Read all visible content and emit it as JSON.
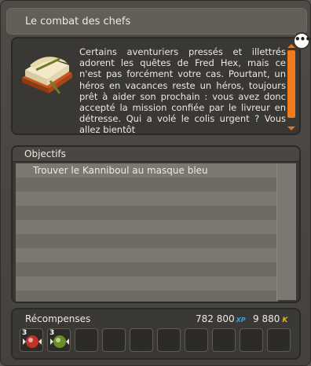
{
  "window": {
    "title": "Le combat des chefs"
  },
  "description": {
    "text": "Certains aventuriers pressés et illettrés adorent les quêtes de Fred Hex, mais ce n'est pas forcément votre cas. Pourtant, un héros en vacances reste un héros, toujours prêt à aider son prochain : vous avez donc accepté la mission confiée par le livreur en détresse. Qui a volé le colis urgent ? Vous allez bientôt"
  },
  "objectives": {
    "header": "Objectifs",
    "items": [
      "Trouver le Kanniboul au masque bleu",
      "",
      "",
      "",
      "",
      "",
      "",
      "",
      "",
      ""
    ]
  },
  "rewards": {
    "title": "Récompenses",
    "xp": "782 800",
    "xp_label": "XP",
    "kamas": "9 880",
    "kamas_label": "K",
    "items": [
      {
        "qty": "3",
        "icon": "red-candy-icon"
      },
      {
        "qty": "3",
        "icon": "green-candy-icon"
      }
    ],
    "empty_slots": 8
  },
  "colors": {
    "accent": "#f07c1c",
    "xp": "#3aa2d8",
    "kamas": "#e8b418"
  }
}
